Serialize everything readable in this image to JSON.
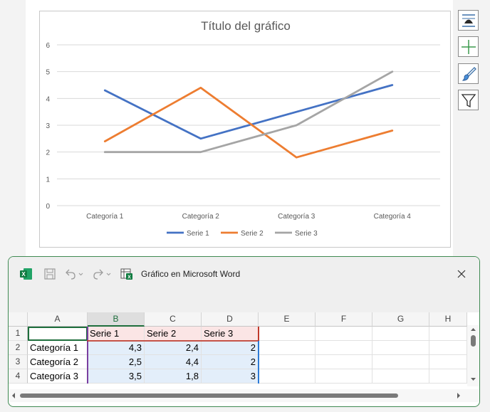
{
  "chart": {
    "title": "Título del gráfico"
  },
  "chart_data": {
    "type": "line",
    "title": "Título del gráfico",
    "categories": [
      "Categoría 1",
      "Categoría 2",
      "Categoría 3",
      "Categoría 4"
    ],
    "series": [
      {
        "name": "Serie 1",
        "values": [
          4.3,
          2.5,
          3.5,
          4.5
        ],
        "color": "#4472c4"
      },
      {
        "name": "Serie 2",
        "values": [
          2.4,
          4.4,
          1.8,
          2.8
        ],
        "color": "#ed7d31"
      },
      {
        "name": "Serie 3",
        "values": [
          2,
          2,
          3,
          5
        ],
        "color": "#a5a5a5"
      }
    ],
    "ylim": [
      0,
      6
    ],
    "yticks": [
      "0",
      "1",
      "2",
      "3",
      "4",
      "5",
      "6"
    ],
    "grid": true,
    "legend": "bottom"
  },
  "side_buttons": [
    {
      "name": "layout-options-icon"
    },
    {
      "name": "chart-elements-icon"
    },
    {
      "name": "chart-styles-icon"
    },
    {
      "name": "chart-filters-icon"
    }
  ],
  "excel": {
    "window_title": "Gráfico en Microsoft Word",
    "columns": [
      "A",
      "B",
      "C",
      "D",
      "E",
      "F",
      "G",
      "H"
    ],
    "rows": [
      {
        "num": "1",
        "cells": [
          "",
          "Serie 1",
          "Serie 2",
          "Serie 3",
          "",
          "",
          "",
          ""
        ]
      },
      {
        "num": "2",
        "cells": [
          "Categoría 1",
          "4,3",
          "2,4",
          "2",
          "",
          "",
          "",
          ""
        ]
      },
      {
        "num": "3",
        "cells": [
          "Categoría 2",
          "2,5",
          "4,4",
          "2",
          "",
          "",
          "",
          ""
        ]
      },
      {
        "num": "4",
        "cells": [
          "Categoría 3",
          "3,5",
          "1,8",
          "3",
          "",
          "",
          "",
          ""
        ]
      }
    ]
  },
  "colors": {
    "excel_green": "#1e6e3c",
    "series1": "#4472c4",
    "series2": "#ed7d31",
    "series3": "#a5a5a5"
  }
}
